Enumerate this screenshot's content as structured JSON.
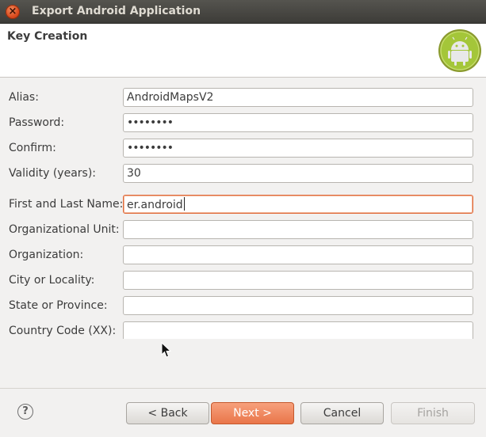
{
  "window": {
    "title": "Export Android Application",
    "close_glyph": "×"
  },
  "header": {
    "title": "Key Creation",
    "logo_icon": "android-logo-icon"
  },
  "form": {
    "fields": [
      {
        "label": "Alias:",
        "value": "AndroidMapsV2"
      },
      {
        "label": "Password:",
        "value": "••••••••"
      },
      {
        "label": "Confirm:",
        "value": "••••••••"
      },
      {
        "label": "Validity (years):",
        "value": "30"
      },
      {
        "label": "First and Last Name:",
        "value": "er.android"
      },
      {
        "label": "Organizational Unit:",
        "value": ""
      },
      {
        "label": "Organization:",
        "value": ""
      },
      {
        "label": "City or Locality:",
        "value": ""
      },
      {
        "label": "State or Province:",
        "value": ""
      },
      {
        "label": "Country Code (XX):",
        "value": ""
      }
    ]
  },
  "footer": {
    "help_glyph": "?",
    "back_label": "< Back",
    "next_label": "Next >",
    "cancel_label": "Cancel",
    "finish_label": "Finish"
  },
  "colors": {
    "accent": "#e9764a",
    "focus_border": "#e06b3c",
    "titlebar": "#3d3c38"
  }
}
